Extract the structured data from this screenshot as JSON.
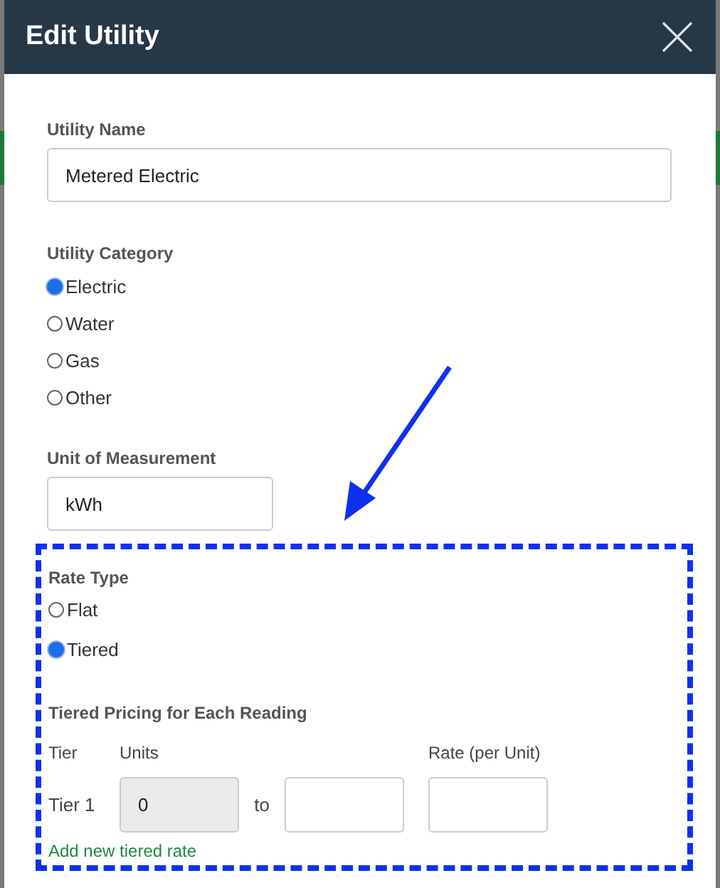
{
  "dialog": {
    "title": "Edit Utility"
  },
  "utility_name": {
    "label": "Utility Name",
    "value": "Metered Electric"
  },
  "utility_category": {
    "label": "Utility Category",
    "options": [
      {
        "label": "Electric",
        "selected": true
      },
      {
        "label": "Water",
        "selected": false
      },
      {
        "label": "Gas",
        "selected": false
      },
      {
        "label": "Other",
        "selected": false
      }
    ]
  },
  "unit_of_measurement": {
    "label": "Unit of Measurement",
    "value": "kWh"
  },
  "rate_type": {
    "label": "Rate Type",
    "options": [
      {
        "label": "Flat",
        "selected": false
      },
      {
        "label": "Tiered",
        "selected": true
      }
    ]
  },
  "tiered_pricing": {
    "label": "Tiered Pricing for Each Reading",
    "columns": [
      "Tier",
      "Units",
      "Rate (per Unit)"
    ],
    "rows": [
      {
        "tier": "Tier 1",
        "from": "0",
        "separator": "to",
        "from_disabled": true
      }
    ],
    "add_link": "Add new tiered rate"
  }
}
